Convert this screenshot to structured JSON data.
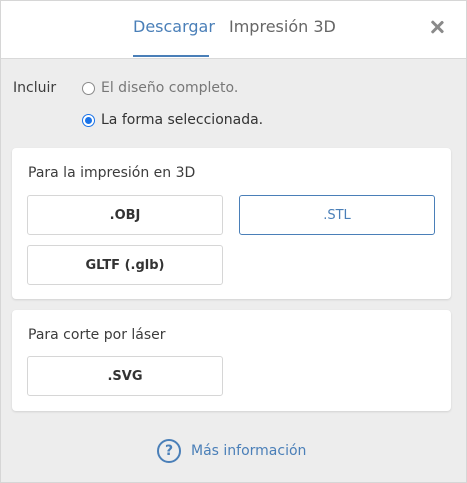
{
  "tabs": [
    {
      "label": "Descargar",
      "active": true
    },
    {
      "label": "Impresión 3D",
      "active": false
    }
  ],
  "close_icon": "close-icon",
  "include": {
    "label": "Incluir",
    "options": [
      {
        "label": "El diseño completo.",
        "checked": false
      },
      {
        "label": "La forma seleccionada.",
        "checked": true
      }
    ]
  },
  "sections": [
    {
      "title": "Para la impresión en 3D",
      "buttons": [
        {
          "label": ".OBJ",
          "selected": false
        },
        {
          "label": ".STL",
          "selected": true
        },
        {
          "label": "GLTF (.glb)",
          "selected": false
        }
      ]
    },
    {
      "title": "Para corte por láser",
      "buttons": [
        {
          "label": ".SVG",
          "selected": false
        }
      ]
    }
  ],
  "footer": {
    "icon": "help-icon",
    "icon_glyph": "?",
    "link_label": "Más información"
  },
  "colors": {
    "accent": "#4a7fb8",
    "radio_checked": "#1a73e8",
    "background": "#ededed"
  }
}
